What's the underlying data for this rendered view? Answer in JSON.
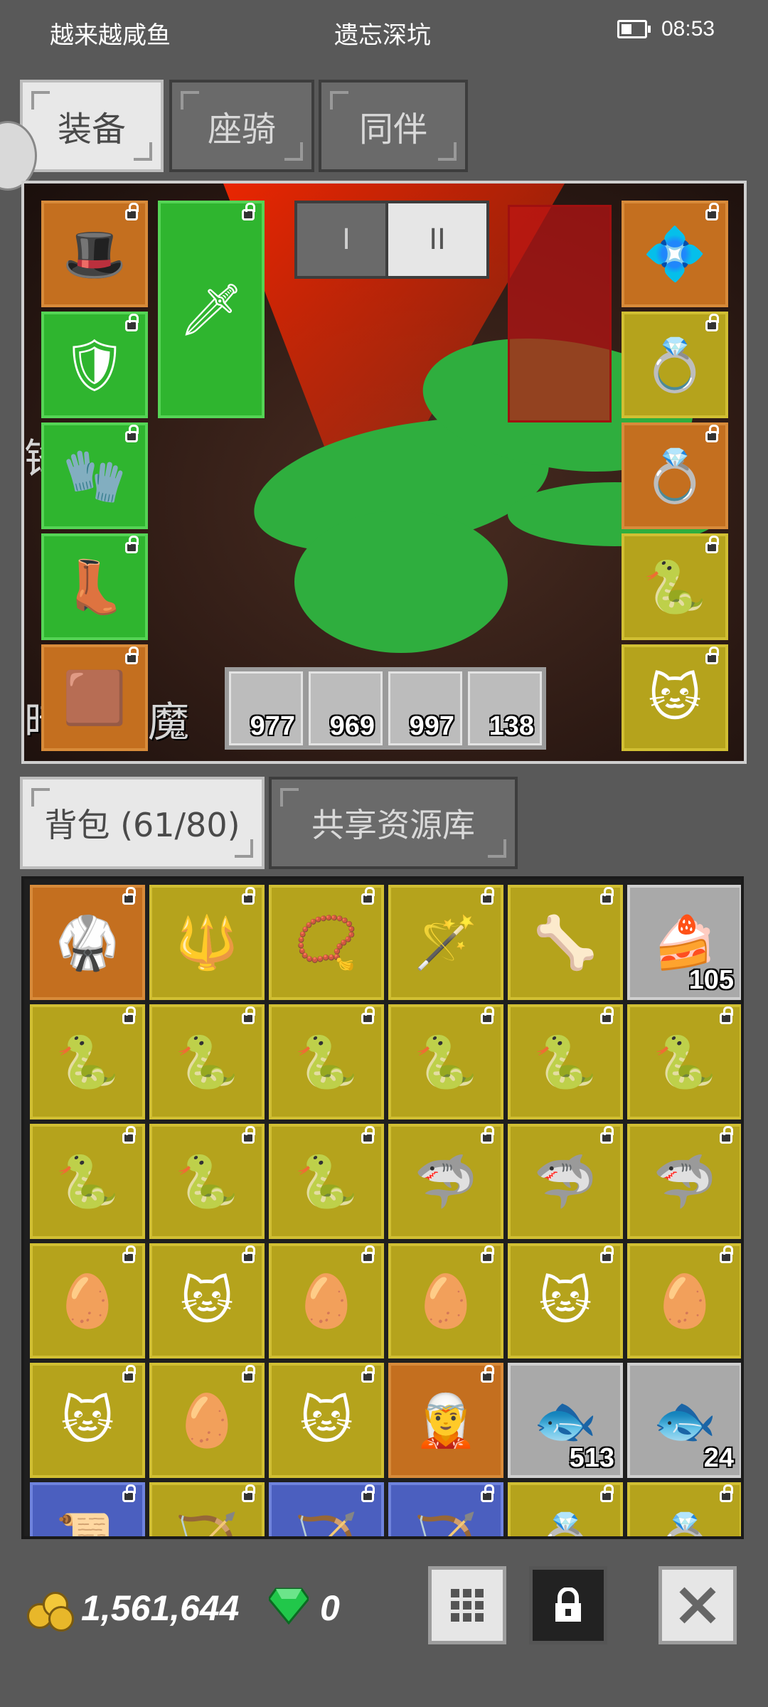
{
  "status_bar": {
    "left_text": "越来越咸鱼",
    "center_text": "遗忘深坑",
    "time": "08:53"
  },
  "top_tabs": [
    {
      "label": "装备",
      "active": true
    },
    {
      "label": "座骑",
      "active": false
    },
    {
      "label": "同伴",
      "active": false
    }
  ],
  "equipment": {
    "pages": [
      "I",
      "II"
    ],
    "active_page": "II",
    "boss_name": "暗血巨魔",
    "side_text": "锋",
    "consumables": [
      {
        "icon": "fish-icon",
        "count": "977"
      },
      {
        "icon": "potion-icon",
        "count": "969"
      },
      {
        "icon": "potion-icon",
        "count": "997"
      },
      {
        "icon": "potion-icon",
        "count": "138"
      }
    ]
  },
  "bag_tabs": [
    {
      "label": "背包 (61/80)",
      "active": true
    },
    {
      "label": "共享资源库",
      "active": false
    }
  ],
  "bag": {
    "items": [
      {
        "icon": "armor-icon",
        "color": "orange",
        "count": ""
      },
      {
        "icon": "spear-icon",
        "color": "yellow",
        "count": ""
      },
      {
        "icon": "amulet-icon",
        "color": "yellow",
        "count": ""
      },
      {
        "icon": "staff-icon",
        "color": "yellow",
        "count": ""
      },
      {
        "icon": "bone-icon",
        "color": "yellow",
        "count": ""
      },
      {
        "icon": "cake-icon",
        "color": "gray",
        "count": "105"
      },
      {
        "icon": "snake-scroll-icon",
        "color": "yellow",
        "count": ""
      },
      {
        "icon": "snake-scroll-icon",
        "color": "yellow",
        "count": ""
      },
      {
        "icon": "snake-scroll-icon",
        "color": "yellow",
        "count": ""
      },
      {
        "icon": "snake-scroll-icon",
        "color": "yellow",
        "count": ""
      },
      {
        "icon": "snake-scroll-icon",
        "color": "yellow",
        "count": ""
      },
      {
        "icon": "snake-scroll-icon",
        "color": "yellow",
        "count": ""
      },
      {
        "icon": "snake-scroll-icon",
        "color": "yellow",
        "count": ""
      },
      {
        "icon": "snake-scroll-icon",
        "color": "yellow",
        "count": ""
      },
      {
        "icon": "snake-scroll-icon",
        "color": "yellow",
        "count": ""
      },
      {
        "icon": "fish-scroll-icon",
        "color": "yellow",
        "count": ""
      },
      {
        "icon": "fish-scroll-icon",
        "color": "yellow",
        "count": ""
      },
      {
        "icon": "fish-scroll-icon",
        "color": "yellow",
        "count": ""
      },
      {
        "icon": "egg-icon",
        "color": "yellow",
        "count": ""
      },
      {
        "icon": "cat-icon",
        "color": "yellow",
        "count": ""
      },
      {
        "icon": "egg-icon",
        "color": "yellow",
        "count": ""
      },
      {
        "icon": "egg-icon",
        "color": "yellow",
        "count": ""
      },
      {
        "icon": "cat-icon",
        "color": "yellow",
        "count": ""
      },
      {
        "icon": "egg-icon",
        "color": "yellow",
        "count": ""
      },
      {
        "icon": "cat-icon",
        "color": "yellow",
        "count": ""
      },
      {
        "icon": "egg-icon",
        "color": "yellow",
        "count": ""
      },
      {
        "icon": "cat-icon",
        "color": "yellow",
        "count": ""
      },
      {
        "icon": "warrior-card-icon",
        "color": "orange",
        "count": ""
      },
      {
        "icon": "fish-icon",
        "color": "gray",
        "count": "513"
      },
      {
        "icon": "fish-icon",
        "color": "gray",
        "count": "24"
      },
      {
        "icon": "scroll-icon",
        "color": "blue",
        "count": ""
      },
      {
        "icon": "bow-icon",
        "color": "yellow",
        "count": ""
      },
      {
        "icon": "bow-icon",
        "color": "blue",
        "count": ""
      },
      {
        "icon": "bow-icon",
        "color": "blue",
        "count": ""
      },
      {
        "icon": "ring-icon",
        "color": "yellow",
        "count": ""
      },
      {
        "icon": "ring-icon",
        "color": "yellow",
        "count": ""
      }
    ]
  },
  "footer": {
    "gold": "1,561,644",
    "diamonds": "0"
  },
  "colors": {
    "orange": "#c46f1f",
    "green": "#2fb52f",
    "yellow": "#b5a31c",
    "gray": "#a9a9a9",
    "blue": "#4b5fbf"
  }
}
